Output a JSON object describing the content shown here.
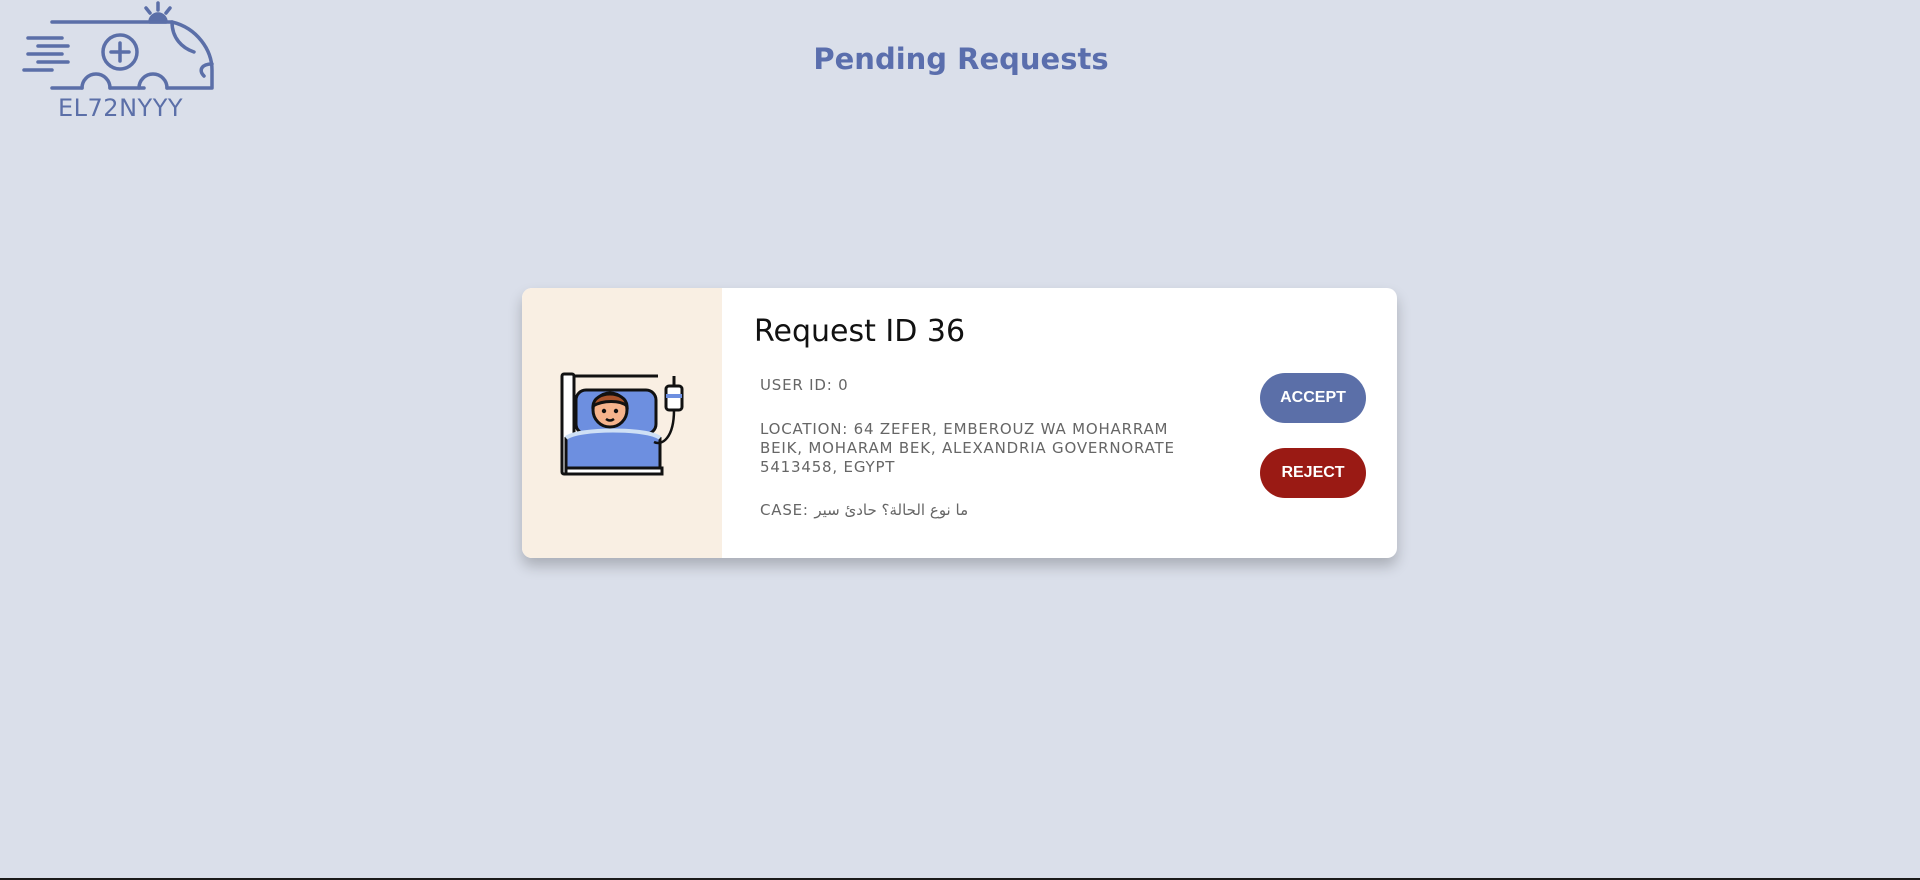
{
  "brand": {
    "logo_icon": "ambulance-icon",
    "name": "EL72NYYY"
  },
  "header": {
    "title": "Pending Requests"
  },
  "request": {
    "image_icon": "patient-in-bed-icon",
    "title": "Request ID 36",
    "user_id": "USER ID: 0",
    "location": "LOCATION: 64 ZEFER, EMBEROUZ WA MOHARRAM BEIK, MOHARAM BEK, ALEXANDRIA GOVERNORATE 5413458, EGYPT",
    "case": "CASE: ما نوع الحالة؟ حادئ سير",
    "accept_label": "ACCEPT",
    "reject_label": "REJECT"
  },
  "colors": {
    "background": "#dadfea",
    "brand": "#5b6fa8",
    "reject": "#9a1a14",
    "card_image_bg": "#f9efe3"
  }
}
